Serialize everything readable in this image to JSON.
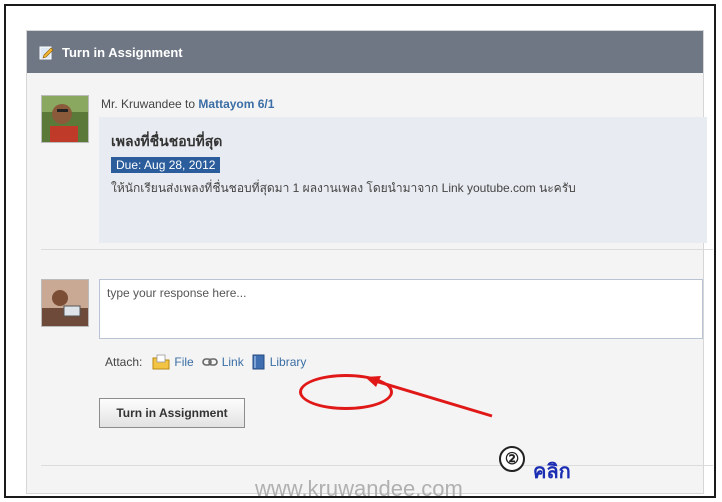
{
  "header": {
    "title": "Turn in Assignment"
  },
  "post": {
    "author": "Mr. Kruwandee",
    "to_word": " to ",
    "class_name": "Mattayom 6/1",
    "title": "เพลงที่ชื่นชอบที่สุด",
    "due": "Due: Aug 28, 2012",
    "body": "ให้นักเรียนส่งเพลงที่ชื่นชอบที่สุดมา 1 ผลงานเพลง โดยนำมาจาก Link youtube.com นะครับ"
  },
  "response": {
    "placeholder": "type your response here..."
  },
  "attach": {
    "label": "Attach:",
    "file": "File",
    "link": "Link",
    "library": "Library"
  },
  "submit_label": "Turn in Assignment",
  "watermark": "www.kruwandee.com",
  "annotation": {
    "step": "②",
    "word": "คลิก",
    "color": "#e01818"
  }
}
